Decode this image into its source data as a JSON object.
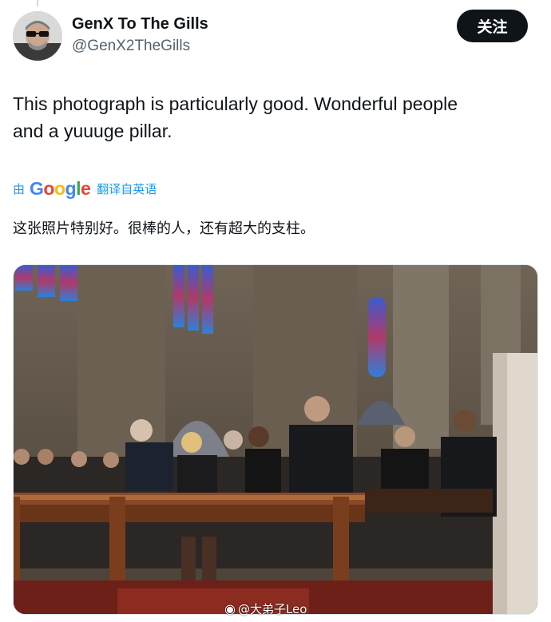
{
  "author": {
    "name": "GenX To The Gills",
    "handle": "@GenX2TheGills"
  },
  "follow_label": "关注",
  "tweet": {
    "line1": "This photograph is particularly good. Wonderful people",
    "line2": "and a yuuuge pillar."
  },
  "translation": {
    "by": "由",
    "provider": "Google",
    "from": "翻译自英语",
    "text": "这张照片特别好。很棒的人，还有超大的支柱。"
  },
  "watermark": {
    "text": "@大弟子Leo"
  },
  "colors": {
    "link_blue": "#1d9bf0",
    "follow_bg": "#0f1419",
    "secondary_text": "#536471",
    "google_blue": "#4285f4",
    "google_red": "#ea4335",
    "google_yellow": "#fbbc05",
    "google_green": "#34a853"
  },
  "icons": {
    "avatar": "avatar-photo",
    "watermark": "weibo-icon"
  }
}
